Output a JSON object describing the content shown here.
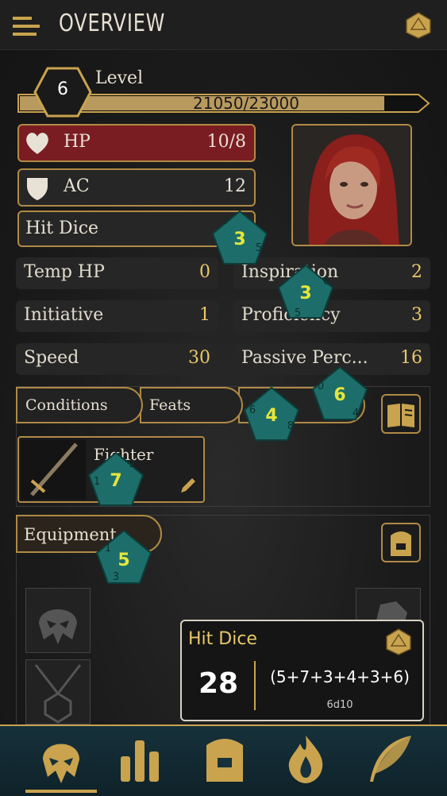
{
  "header": {
    "title": "OVERVIEW"
  },
  "level": {
    "label": "Level",
    "value": "6",
    "xp_text": "21050/23000",
    "xp_progress": 0.915
  },
  "stats": {
    "hp": {
      "label": "HP",
      "value": "10/8"
    },
    "ac": {
      "label": "AC",
      "value": "12"
    },
    "hit_dice": {
      "label": "Hit Dice"
    }
  },
  "secondary": {
    "temp_hp": {
      "label": "Temp HP",
      "value": "0"
    },
    "inspiration": {
      "label": "Inspiration",
      "value": "2"
    },
    "initiative": {
      "label": "Initiative",
      "value": "1"
    },
    "proficiency": {
      "label": "Proficiency",
      "value": "3"
    },
    "speed": {
      "label": "Speed",
      "value": "30"
    },
    "passive": {
      "label": "Passive Perc...",
      "value": "16"
    }
  },
  "tabs": [
    "Conditions",
    "Feats"
  ],
  "class_card": {
    "name": "Fighter"
  },
  "equipment": {
    "label": "Equipment"
  },
  "dice": [
    {
      "value": "3",
      "side_a": "9",
      "side_b": "5"
    },
    {
      "value": "3",
      "side_a": "6",
      "side_b": "5"
    },
    {
      "value": "6",
      "side_a": "0",
      "side_b": "4"
    },
    {
      "value": "4",
      "side_a": "6",
      "side_b": "8"
    },
    {
      "value": "7",
      "side_a": "1",
      "side_b": "9"
    },
    {
      "value": "5",
      "side_a": "1",
      "side_b": "3"
    }
  ],
  "popup": {
    "title": "Hit Dice",
    "total": "28",
    "formula": "(5+7+3+4+3+6)",
    "notation": "6d10"
  },
  "colors": {
    "gold": "#c9a34e",
    "hp_red": "#7a1d22",
    "die_teal": "#1d6e6a",
    "die_number": "#e6e63a"
  },
  "nav": [
    "character-icon",
    "stats-icon",
    "inventory-icon",
    "spells-icon",
    "notes-icon"
  ]
}
